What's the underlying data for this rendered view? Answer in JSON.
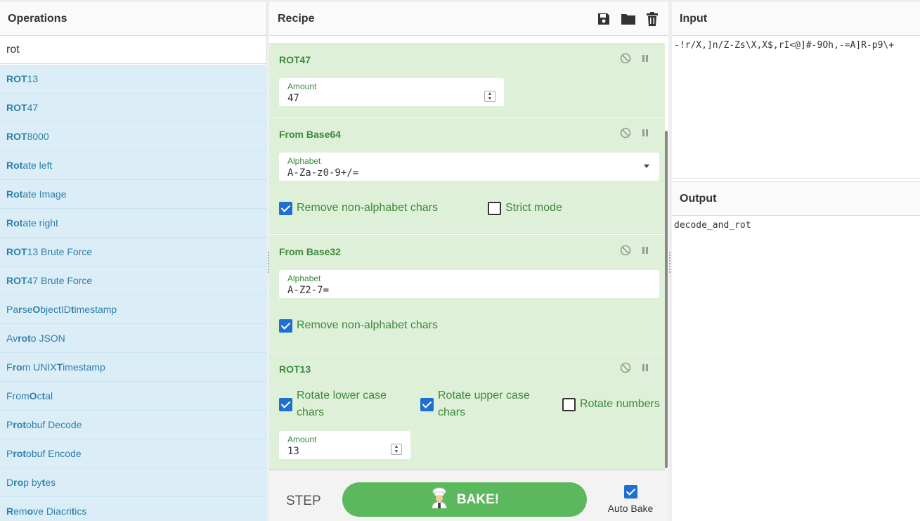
{
  "operations": {
    "title": "Operations",
    "search_value": "rot",
    "items": [
      {
        "pre": "",
        "bold": "ROT",
        "post": "13"
      },
      {
        "pre": "",
        "bold": "ROT",
        "post": "47"
      },
      {
        "pre": "",
        "bold": "ROT",
        "post": "8000"
      },
      {
        "pre": "",
        "bold": "Rot",
        "post": "ate left"
      },
      {
        "pre": "",
        "bold": "Rot",
        "post": "ate Image"
      },
      {
        "pre": "",
        "bold": "Rot",
        "post": "ate right"
      },
      {
        "pre": "",
        "bold": "ROT",
        "post": "13 Brute Force"
      },
      {
        "pre": "",
        "bold": "ROT",
        "post": "47 Brute Force"
      },
      {
        "segments": [
          [
            "Pa",
            false
          ],
          [
            "r",
            true
          ],
          [
            "se ",
            false
          ],
          [
            "O",
            true
          ],
          [
            "bjectID ",
            false
          ],
          [
            "t",
            true
          ],
          [
            "imestamp",
            false
          ]
        ]
      },
      {
        "segments": [
          [
            "Av",
            false
          ],
          [
            "ro",
            true
          ],
          [
            " ",
            false
          ],
          [
            "t",
            true
          ],
          [
            "o JSON",
            false
          ]
        ]
      },
      {
        "segments": [
          [
            "F",
            false
          ],
          [
            "ro",
            true
          ],
          [
            "m UNIX ",
            false
          ],
          [
            "T",
            true
          ],
          [
            "imestamp",
            false
          ]
        ]
      },
      {
        "segments": [
          [
            "From ",
            false
          ],
          [
            "O",
            true
          ],
          [
            "c",
            false
          ],
          [
            "t",
            true
          ],
          [
            "al",
            false
          ]
        ]
      },
      {
        "segments": [
          [
            "P",
            false
          ],
          [
            "r",
            true
          ],
          [
            "o",
            true
          ],
          [
            "t",
            true
          ],
          [
            "obuf Decode",
            false
          ]
        ]
      },
      {
        "segments": [
          [
            "P",
            false
          ],
          [
            "r",
            true
          ],
          [
            "o",
            true
          ],
          [
            "t",
            true
          ],
          [
            "obuf Encode",
            false
          ]
        ]
      },
      {
        "segments": [
          [
            "D",
            false
          ],
          [
            "r",
            true
          ],
          [
            "o",
            true
          ],
          [
            "p by",
            false
          ],
          [
            "t",
            true
          ],
          [
            "es",
            false
          ]
        ]
      },
      {
        "segments": [
          [
            "R",
            true
          ],
          [
            "em",
            false
          ],
          [
            "o",
            true
          ],
          [
            "ve Diacri",
            false
          ],
          [
            "t",
            true
          ],
          [
            "ics",
            false
          ]
        ]
      }
    ]
  },
  "recipe": {
    "title": "Recipe",
    "ops": [
      {
        "name": "ROT47",
        "amount_label": "Amount",
        "amount_value": "47"
      },
      {
        "name": "From Base64",
        "alphabet_label": "Alphabet",
        "alphabet_value": "A-Za-z0-9+/=",
        "checkbox1": "Remove non-alphabet chars",
        "checkbox2": "Strict mode"
      },
      {
        "name": "From Base32",
        "alphabet_label": "Alphabet",
        "alphabet_value": "A-Z2-7=",
        "checkbox1": "Remove non-alphabet chars"
      },
      {
        "name": "ROT13",
        "check_lower": "Rotate lower case chars",
        "check_upper": "Rotate upper case chars",
        "check_numbers": "Rotate numbers",
        "amount_label": "Amount",
        "amount_value": "13"
      }
    ]
  },
  "controls": {
    "step_label": "STEP",
    "bake_label": "BAKE!",
    "autobake_label": "Auto Bake"
  },
  "input": {
    "title": "Input",
    "value": "-!r/X,]n/Z-Zs\\X,X$,rI<@]#-9Oh,-=A]R-p9\\+"
  },
  "output": {
    "title": "Output",
    "value": "decode_and_rot"
  },
  "colors": {
    "op_list_bg": "#dbeef7",
    "op_list_text": "#2e7fa8",
    "recipe_bg": "#dff0d8",
    "recipe_text": "#3c8a3c",
    "bake": "#5cb85c",
    "checkbox": "#1e6fd1"
  }
}
